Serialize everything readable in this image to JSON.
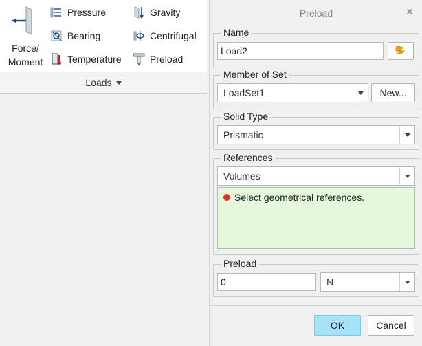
{
  "ribbon": {
    "force_moment_label_1": "Force/",
    "force_moment_label_2": "Moment",
    "items": {
      "pressure": "Pressure",
      "bearing": "Bearing",
      "temperature": "Temperature",
      "gravity": "Gravity",
      "centrifugal": "Centrifugal",
      "preload": "Preload"
    },
    "group_label": "Loads"
  },
  "dialog": {
    "title": "Preload",
    "close_glyph": "×",
    "name": {
      "label": "Name",
      "value": "Load2"
    },
    "member_of_set": {
      "label": "Member of Set",
      "selected": "LoadSet1",
      "new_button": "New..."
    },
    "solid_type": {
      "label": "Solid Type",
      "selected": "Prismatic"
    },
    "references": {
      "label": "References",
      "selected": "Volumes",
      "message": "Select geometrical references."
    },
    "preload": {
      "label": "Preload",
      "value": "0",
      "unit": "N"
    },
    "ok_label": "OK",
    "cancel_label": "Cancel"
  },
  "colors": {
    "accent_ok": "#a8e2f8",
    "reference_box": "#e6f8dc",
    "error_dot": "#e03020",
    "appearance_icon": "#f4a400"
  },
  "icons": [
    "force-moment-icon",
    "pressure-icon",
    "bearing-icon",
    "temperature-icon",
    "gravity-icon",
    "centrifugal-icon",
    "preload-icon",
    "appearance-icon"
  ]
}
